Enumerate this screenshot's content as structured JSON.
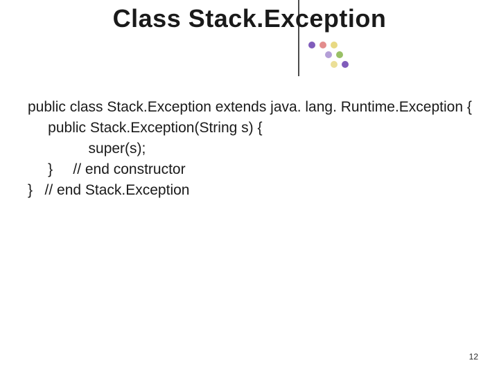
{
  "title": "Class Stack.Exception",
  "code_lines": [
    "public class Stack.Exception extends java. lang. Runtime.Exception {",
    "     public Stack.Exception(String s) {",
    "               super(s);",
    "     }     // end constructor",
    "}   // end Stack.Exception"
  ],
  "page_number": "12"
}
